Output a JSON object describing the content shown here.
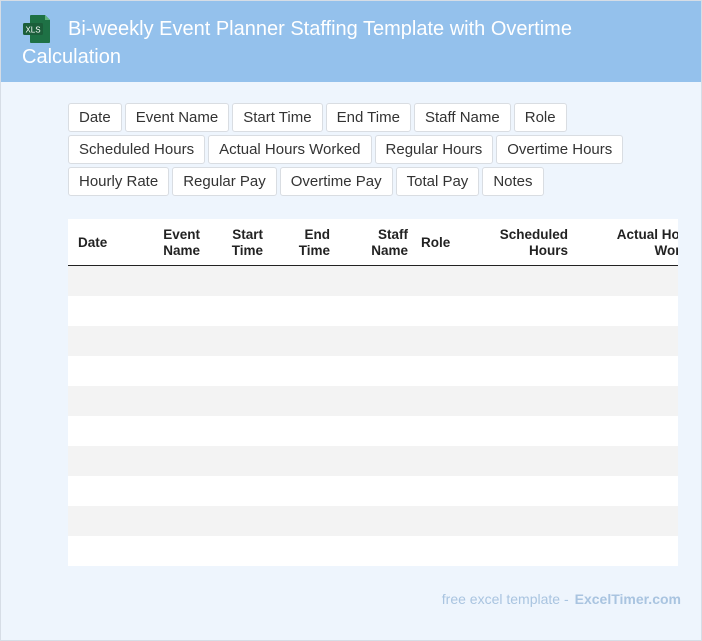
{
  "header": {
    "title": "Bi-weekly Event Planner Staffing Template with Overtime Calculation",
    "icon": "xls-file-icon",
    "icon_label": "XLS",
    "background": "#94c1ec"
  },
  "columns": [
    "Date",
    "Event Name",
    "Start Time",
    "End Time",
    "Staff Name",
    "Role",
    "Scheduled Hours",
    "Actual Hours Worked",
    "Regular Hours",
    "Overtime Hours",
    "Hourly Rate",
    "Regular Pay",
    "Overtime Pay",
    "Total Pay",
    "Notes"
  ],
  "table": {
    "headers": [
      {
        "line1": "Date",
        "line2": ""
      },
      {
        "line1": "Event",
        "line2": "Name"
      },
      {
        "line1": "Start",
        "line2": "Time"
      },
      {
        "line1": "End",
        "line2": "Time"
      },
      {
        "line1": "Staff",
        "line2": "Name"
      },
      {
        "line1": "Role",
        "line2": ""
      },
      {
        "line1": "Scheduled",
        "line2": "Hours"
      },
      {
        "line1": "Actual Hou",
        "line2": "Work"
      }
    ],
    "row_count": 10,
    "shade_color": "#f3f3f3"
  },
  "footer": {
    "text": "free excel template -",
    "brand": "ExcelTimer.com"
  }
}
